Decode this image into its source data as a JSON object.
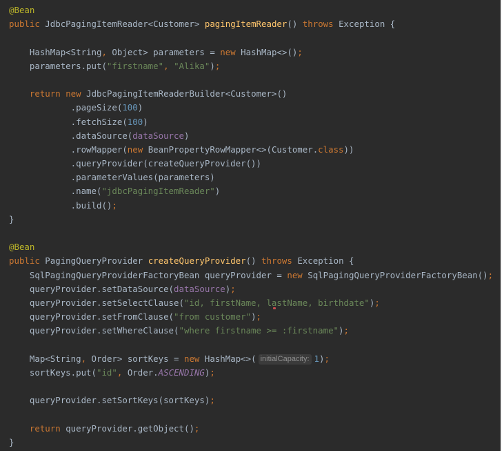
{
  "editor": {
    "colors": {
      "background": "#2b2b2b",
      "plain": "#a9b7c6",
      "keyword": "#cc7832",
      "punct": "#cc7832",
      "annotation": "#bbb529",
      "string": "#6a8759",
      "number": "#6897bb",
      "method": "#ffc66d",
      "field": "#9876aa",
      "constant": "#9876aa",
      "hint_text": "#8f8f8f",
      "hint_background": "#3b3b3b"
    },
    "lines": [
      {
        "tokens": [
          {
            "text": "@Bean",
            "kind": "annotation"
          }
        ]
      },
      {
        "tokens": [
          {
            "text": "public",
            "kind": "keyword"
          },
          {
            "text": " JdbcPagingItemReader<Customer> ",
            "kind": "plain"
          },
          {
            "text": "pagingItemReader",
            "kind": "method"
          },
          {
            "text": "() ",
            "kind": "plain"
          },
          {
            "text": "throws",
            "kind": "keyword"
          },
          {
            "text": " Exception {",
            "kind": "plain"
          }
        ]
      },
      {
        "tokens": []
      },
      {
        "tokens": [
          {
            "text": "    HashMap<String",
            "kind": "plain"
          },
          {
            "text": ",",
            "kind": "punct"
          },
          {
            "text": " Object> parameters = ",
            "kind": "plain"
          },
          {
            "text": "new",
            "kind": "keyword"
          },
          {
            "text": " HashMap<>()",
            "kind": "plain"
          },
          {
            "text": ";",
            "kind": "punct"
          }
        ]
      },
      {
        "tokens": [
          {
            "text": "    parameters.put(",
            "kind": "plain"
          },
          {
            "text": "\"firstname\"",
            "kind": "string"
          },
          {
            "text": ",",
            "kind": "punct"
          },
          {
            "text": " ",
            "kind": "plain"
          },
          {
            "text": "\"Alika\"",
            "kind": "string"
          },
          {
            "text": ")",
            "kind": "plain"
          },
          {
            "text": ";",
            "kind": "punct"
          }
        ]
      },
      {
        "tokens": []
      },
      {
        "tokens": [
          {
            "text": "    ",
            "kind": "plain"
          },
          {
            "text": "return",
            "kind": "keyword"
          },
          {
            "text": " ",
            "kind": "plain"
          },
          {
            "text": "new",
            "kind": "keyword"
          },
          {
            "text": " JdbcPagingItemReaderBuilder<Customer>()",
            "kind": "plain"
          }
        ]
      },
      {
        "tokens": [
          {
            "text": "            .pageSize(",
            "kind": "plain"
          },
          {
            "text": "100",
            "kind": "number"
          },
          {
            "text": ")",
            "kind": "plain"
          }
        ]
      },
      {
        "tokens": [
          {
            "text": "            .fetchSize(",
            "kind": "plain"
          },
          {
            "text": "100",
            "kind": "number"
          },
          {
            "text": ")",
            "kind": "plain"
          }
        ]
      },
      {
        "tokens": [
          {
            "text": "            .dataSource(",
            "kind": "plain"
          },
          {
            "text": "dataSource",
            "kind": "field"
          },
          {
            "text": ")",
            "kind": "plain"
          }
        ]
      },
      {
        "tokens": [
          {
            "text": "            .rowMapper(",
            "kind": "plain"
          },
          {
            "text": "new",
            "kind": "keyword"
          },
          {
            "text": " BeanPropertyRowMapper<>(Customer.",
            "kind": "plain"
          },
          {
            "text": "class",
            "kind": "keyword"
          },
          {
            "text": "))",
            "kind": "plain"
          }
        ]
      },
      {
        "tokens": [
          {
            "text": "            .queryProvider(createQueryProvider())",
            "kind": "plain"
          }
        ]
      },
      {
        "tokens": [
          {
            "text": "            .parameterValues(parameters)",
            "kind": "plain"
          }
        ]
      },
      {
        "tokens": [
          {
            "text": "            .name(",
            "kind": "plain"
          },
          {
            "text": "\"jdbcPagingItemReader\"",
            "kind": "string"
          },
          {
            "text": ")",
            "kind": "plain"
          }
        ]
      },
      {
        "tokens": [
          {
            "text": "            .build()",
            "kind": "plain"
          },
          {
            "text": ";",
            "kind": "punct"
          }
        ]
      },
      {
        "tokens": [
          {
            "text": "}",
            "kind": "plain"
          }
        ]
      },
      {
        "tokens": []
      },
      {
        "tokens": [
          {
            "text": "@Bean",
            "kind": "annotation"
          }
        ]
      },
      {
        "tokens": [
          {
            "text": "public",
            "kind": "keyword"
          },
          {
            "text": " PagingQueryProvider ",
            "kind": "plain"
          },
          {
            "text": "createQueryProvider",
            "kind": "method"
          },
          {
            "text": "() ",
            "kind": "plain"
          },
          {
            "text": "throws",
            "kind": "keyword"
          },
          {
            "text": " Exception {",
            "kind": "plain"
          }
        ]
      },
      {
        "tokens": [
          {
            "text": "    SqlPagingQueryProviderFactoryBean queryProvider = ",
            "kind": "plain"
          },
          {
            "text": "new",
            "kind": "keyword"
          },
          {
            "text": " SqlPagingQueryProviderFactoryBean()",
            "kind": "plain"
          },
          {
            "text": ";",
            "kind": "punct"
          }
        ]
      },
      {
        "tokens": [
          {
            "text": "    queryProvider.setDataSource(",
            "kind": "plain"
          },
          {
            "text": "dataSource",
            "kind": "field"
          },
          {
            "text": ")",
            "kind": "plain"
          },
          {
            "text": ";",
            "kind": "punct"
          }
        ]
      },
      {
        "tokens": [
          {
            "text": "    queryProvider.setSelectClause(",
            "kind": "plain"
          },
          {
            "text": "\"id, firstName, lastName, birthdate\"",
            "kind": "string"
          },
          {
            "text": ")",
            "kind": "plain"
          },
          {
            "text": ";",
            "kind": "punct"
          }
        ]
      },
      {
        "tokens": [
          {
            "text": "    queryProvider.setFromClause(",
            "kind": "plain"
          },
          {
            "text": "\"from customer\"",
            "kind": "string"
          },
          {
            "text": ")",
            "kind": "plain"
          },
          {
            "text": ";",
            "kind": "punct"
          }
        ]
      },
      {
        "tokens": [
          {
            "text": "    queryProvider.setWhereClause(",
            "kind": "plain"
          },
          {
            "text": "\"where firstname >= :firstname\"",
            "kind": "string"
          },
          {
            "text": ")",
            "kind": "plain"
          },
          {
            "text": ";",
            "kind": "punct"
          }
        ]
      },
      {
        "tokens": []
      },
      {
        "tokens": [
          {
            "text": "    Map<String",
            "kind": "plain"
          },
          {
            "text": ",",
            "kind": "punct"
          },
          {
            "text": " Order> sortKeys = ",
            "kind": "plain"
          },
          {
            "text": "new",
            "kind": "keyword"
          },
          {
            "text": " HashMap<>(",
            "kind": "plain"
          },
          {
            "text": "initialCapacity:",
            "kind": "hint"
          },
          {
            "text": "1",
            "kind": "number"
          },
          {
            "text": ")",
            "kind": "plain"
          },
          {
            "text": ";",
            "kind": "punct"
          }
        ]
      },
      {
        "tokens": [
          {
            "text": "    sortKeys.put(",
            "kind": "plain"
          },
          {
            "text": "\"id\"",
            "kind": "string"
          },
          {
            "text": ",",
            "kind": "punct"
          },
          {
            "text": " Order.",
            "kind": "plain"
          },
          {
            "text": "ASCENDING",
            "kind": "constant"
          },
          {
            "text": ")",
            "kind": "plain"
          },
          {
            "text": ";",
            "kind": "punct"
          }
        ]
      },
      {
        "tokens": []
      },
      {
        "tokens": [
          {
            "text": "    queryProvider.setSortKeys(sortKeys)",
            "kind": "plain"
          },
          {
            "text": ";",
            "kind": "punct"
          }
        ]
      },
      {
        "tokens": []
      },
      {
        "tokens": [
          {
            "text": "    ",
            "kind": "plain"
          },
          {
            "text": "return",
            "kind": "keyword"
          },
          {
            "text": " queryProvider.getObject()",
            "kind": "plain"
          },
          {
            "text": ";",
            "kind": "punct"
          }
        ]
      },
      {
        "tokens": [
          {
            "text": "}",
            "kind": "plain"
          }
        ]
      }
    ]
  }
}
